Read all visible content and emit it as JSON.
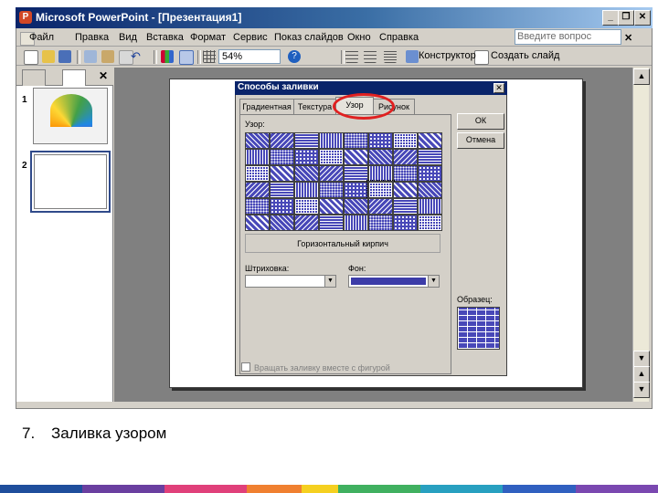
{
  "window": {
    "title": "Microsoft PowerPoint - [Презентация1]",
    "app_icon": "powerpoint-icon"
  },
  "menubar": {
    "items": [
      "Файл",
      "Правка",
      "Вид",
      "Вставка",
      "Формат",
      "Сервис",
      "Показ слайдов",
      "Окно",
      "Справка"
    ],
    "ask_placeholder": "Введите вопрос"
  },
  "toolbar": {
    "zoom": "54%",
    "designer_label": "Конструктор",
    "new_slide_label": "Создать слайд"
  },
  "slides_panel": {
    "slide_numbers": [
      "1",
      "2"
    ]
  },
  "dialog": {
    "title": "Способы заливки",
    "tabs": [
      "Градиентная",
      "Текстура",
      "Узор",
      "Рисунок"
    ],
    "selected_tab": "Узор",
    "pattern_label": "Узор:",
    "pattern_name": "Горизонтальный кирпич",
    "hatch_label": "Штриховка:",
    "bg_label": "Фон:",
    "ok_label": "ОК",
    "cancel_label": "Отмена",
    "sample_label": "Образец:",
    "rotate_label": "Вращать заливку вместе с фигурой",
    "accent_color": "#4848b8"
  },
  "caption": {
    "number": "7.",
    "text": "Заливка узором"
  }
}
